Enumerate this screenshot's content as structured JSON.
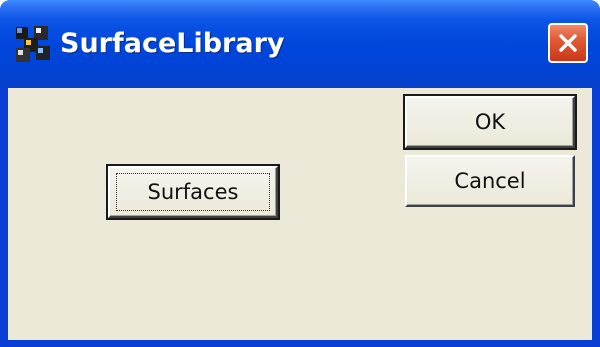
{
  "window": {
    "title": "SurfaceLibrary",
    "app_icon": "surface-library-app-icon",
    "close_icon": "close-x-icon"
  },
  "buttons": {
    "ok_label": "OK",
    "cancel_label": "Cancel",
    "surfaces_label": "Surfaces"
  },
  "colors": {
    "titlebar": "#0046dc",
    "client_background": "#ece9d8",
    "close_button": "#e25a36"
  }
}
